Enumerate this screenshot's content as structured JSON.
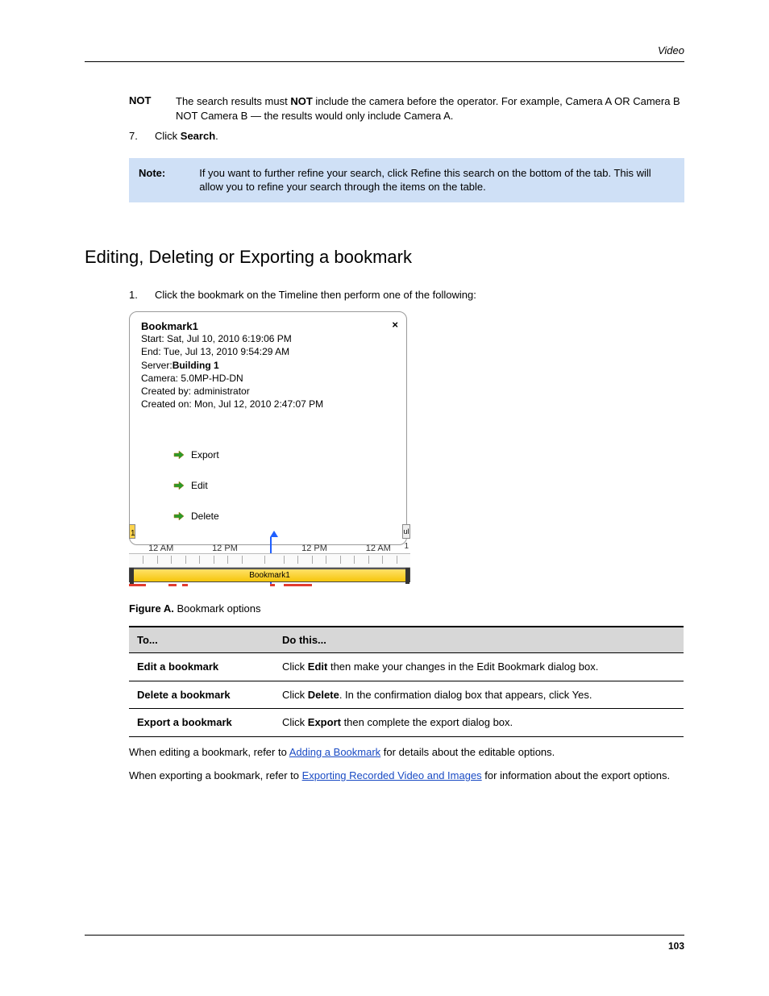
{
  "header": {
    "section": "Video"
  },
  "intro_boolean": {
    "term": "NOT",
    "desc_prefix": "The search results must ",
    "desc_bold": "NOT",
    "desc_suffix": " include the camera before the operator. For example, Camera A OR Camera B NOT Camera B — the results would only include Camera A."
  },
  "step7": {
    "num": "7.",
    "text_prefix": "Click ",
    "button": "Search",
    "text_suffix": "."
  },
  "note": {
    "label": "Note:",
    "text": "If you want to further refine your search, click Refine this search on the bottom of the tab. This will allow you to refine your search through the items on the table."
  },
  "section_title": "Editing, Deleting or Exporting a bookmark",
  "step1": {
    "num": "1.",
    "text": "Click the bookmark on the Timeline then perform one of the following:"
  },
  "popup": {
    "title": "Bookmark1",
    "start": "Start: Sat, Jul 10, 2010 6:19:06 PM",
    "end": "End: Tue, Jul 13, 2010 9:54:29 AM",
    "server_label": "Server:",
    "server_value": "Building 1",
    "camera": "Camera: 5.0MP-HD-DN",
    "created_by": "Created by: administrator",
    "created_on": "Created on: Mon, Jul 12, 2010 2:47:07 PM",
    "actions": {
      "export": "Export",
      "edit": "Edit",
      "delete": "Delete"
    }
  },
  "timeline": {
    "labels": [
      "12 AM",
      "12 PM",
      "12 PM",
      "12 AM"
    ],
    "bookmark_label": "Bookmark1",
    "left_num": "1",
    "right_text": "ul",
    "right_num": "1"
  },
  "figure_caption": {
    "label": "Figure A. ",
    "text": "Bookmark options"
  },
  "table": {
    "head": [
      "To...",
      "Do this..."
    ],
    "rows": [
      {
        "to": "Edit a bookmark",
        "do_prefix": "Click ",
        "do_bold": "Edit",
        "do_suffix": " then make your changes in the Edit Bookmark dialog box."
      },
      {
        "to": "Delete a bookmark",
        "do_prefix": "Click ",
        "do_bold": "Delete",
        "do_suffix": ". In the confirmation dialog box that appears, click Yes."
      },
      {
        "to": "Export a bookmark",
        "do_prefix": "Click ",
        "do_bold": "Export",
        "do_suffix": " then complete the export dialog box."
      }
    ]
  },
  "refs": {
    "line1_prefix": "When editing a bookmark, refer to ",
    "link1": "Adding a Bookmark",
    "line1_suffix": " for details about the editable options.",
    "line2_prefix": "When exporting a bookmark, refer to ",
    "link2": "Exporting Recorded Video and Images",
    "line2_suffix": " for information about the export options."
  },
  "footer": {
    "page": "103"
  }
}
